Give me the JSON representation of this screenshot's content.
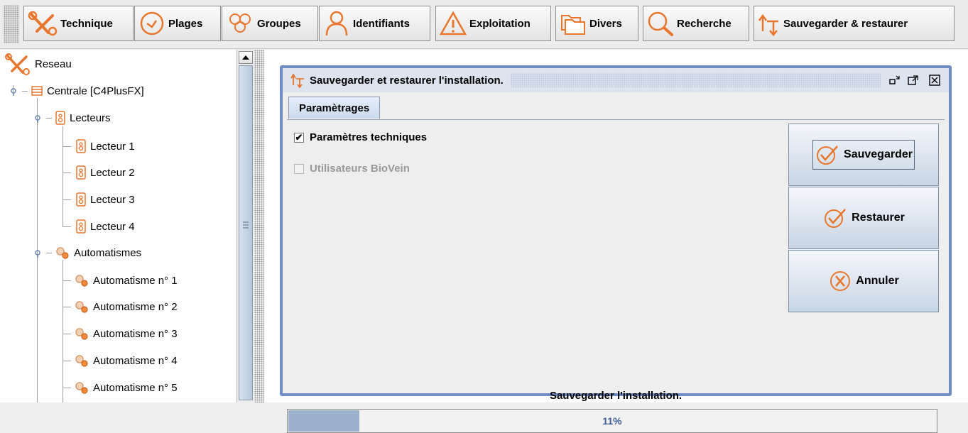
{
  "toolbar": {
    "items": [
      {
        "label": "Technique",
        "icon": "tools-icon"
      },
      {
        "label": "Plages",
        "icon": "clock-icon"
      },
      {
        "label": "Groupes",
        "icon": "group-icon"
      },
      {
        "label": "Identifiants",
        "icon": "person-icon"
      },
      {
        "label": "Exploitation",
        "icon": "warning-icon"
      },
      {
        "label": "Divers",
        "icon": "folders-icon"
      },
      {
        "label": "Recherche",
        "icon": "search-icon"
      },
      {
        "label": "Sauvegarder & restaurer",
        "icon": "save-restore-icon"
      }
    ]
  },
  "tree": {
    "root": "Reseau",
    "centrale": "Centrale [C4PlusFX]",
    "lecteurs": "Lecteurs",
    "lecteur_items": [
      "Lecteur 1",
      "Lecteur 2",
      "Lecteur 3",
      "Lecteur 4"
    ],
    "automatismes": "Automatismes",
    "automatisme_items": [
      "Automatisme n° 1",
      "Automatisme n° 2",
      "Automatisme n° 3",
      "Automatisme n° 4",
      "Automatisme n° 5"
    ]
  },
  "dialog": {
    "title": "Sauvegarder et restaurer l'installation.",
    "tab": "Paramètrages",
    "options": [
      {
        "label": "Paramètres techniques",
        "checked": true,
        "enabled": true
      },
      {
        "label": "Utilisateurs BioVein",
        "checked": false,
        "enabled": false
      }
    ],
    "buttons": {
      "save": "Sauvegarder",
      "restore": "Restaurer",
      "cancel": "Annuler"
    },
    "status": "Sauvegarder l'installation.",
    "progress": {
      "value": 0.11,
      "label": "11%"
    }
  },
  "colors": {
    "accent": "#e8762d",
    "frame": "#6f8cc4",
    "progress": "#9bb1cc"
  }
}
